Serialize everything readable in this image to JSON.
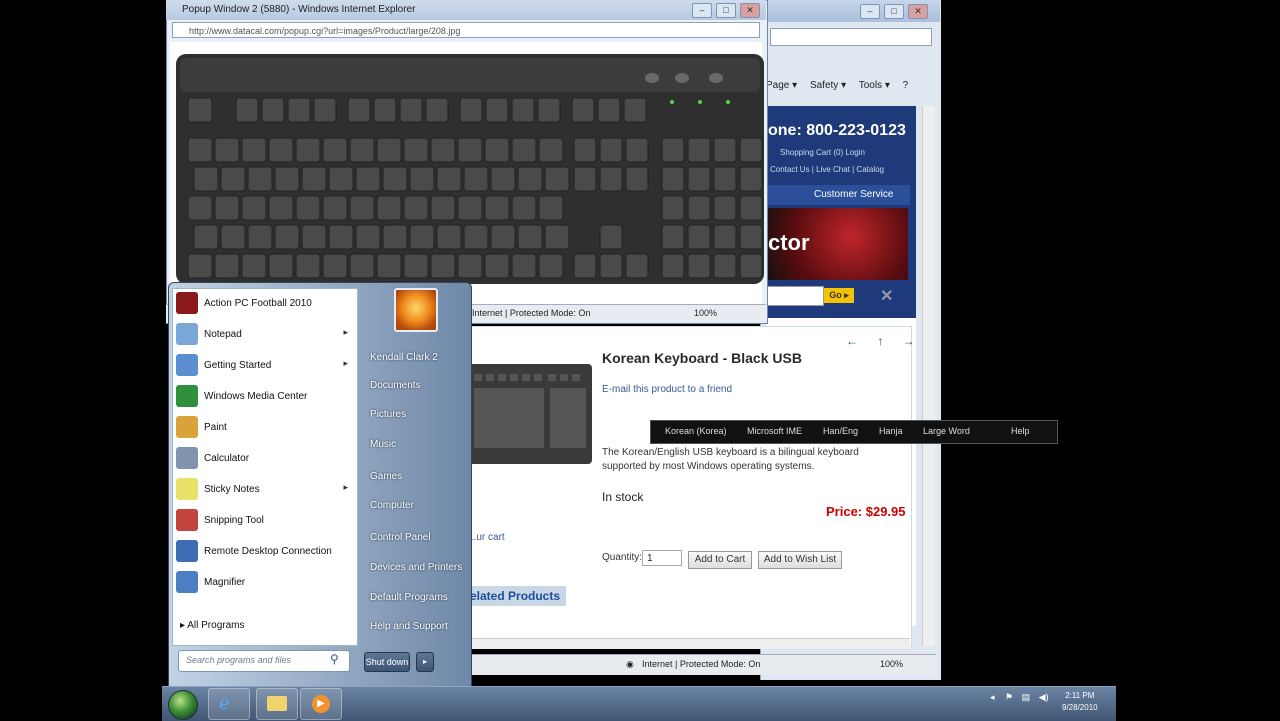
{
  "bg_window": {
    "cmdbar": [
      "Page ▾",
      "Safety ▾",
      "Tools ▾",
      "?"
    ],
    "phone": "one: 800-223-0123",
    "links_row1": "Shopping Cart (0)   Login",
    "links_row2": "Contact Us | Live Chat | Catalog",
    "nav": "Customer Service",
    "banner_text": "ctor",
    "go_button": "Go ▸",
    "status_text": "Internet | Protected Mode: On",
    "zoom": "100%"
  },
  "product": {
    "nav_arrows": "← ↑ →",
    "title": "Korean Keyboard - Black USB",
    "email_link": "E-mail this product to a friend",
    "description": "The Korean/English USB keyboard is a bilingual keyboard supported by most Windows operating systems.",
    "stock": "In stock",
    "price": "Price: $29.95",
    "quantity_label": "Quantity:",
    "quantity_value": "1",
    "add_to_cart": "Add to Cart",
    "add_to_wishlist": "Add to Wish List",
    "cart_link": "...ur cart",
    "related_tab": "elated Products"
  },
  "langbar": {
    "lang": "Korean (Korea)",
    "ime": "Microsoft IME",
    "hanja": "Han/Eng",
    "hangul": "Hanja",
    "large_word": "Large Word",
    "help": "Help"
  },
  "popup": {
    "title": "Popup Window 2 (5880) - Windows Internet Explorer",
    "address": "http://www.datacal.com/popup.cgi?url=images/Product/large/208.jpg",
    "status": "Internet | Protected Mode: On",
    "zoom": "100%"
  },
  "start_menu": {
    "programs": [
      {
        "label": "Action PC Football 2010",
        "arrow": "",
        "color": "#8b1a1a"
      },
      {
        "label": "Notepad",
        "arrow": "▸",
        "color": "#7aa7d6"
      },
      {
        "label": "Getting Started",
        "arrow": "▸",
        "color": "#5c8fd0"
      },
      {
        "label": "Windows Media Center",
        "arrow": "",
        "color": "#2f8f3a"
      },
      {
        "label": "Paint",
        "arrow": "",
        "color": "#d9a23b"
      },
      {
        "label": "Calculator",
        "arrow": "",
        "color": "#8095ad"
      },
      {
        "label": "Sticky Notes",
        "arrow": "▸",
        "color": "#e8e26a"
      },
      {
        "label": "Snipping Tool",
        "arrow": "",
        "color": "#c2453d"
      },
      {
        "label": "Remote Desktop Connection",
        "arrow": "",
        "color": "#3e6db3"
      },
      {
        "label": "Magnifier",
        "arrow": "",
        "color": "#4a7fc4"
      }
    ],
    "all_programs": "▸  All Programs",
    "search_placeholder": "Search programs and files",
    "right_items": [
      "Kendall Clark 2",
      "Documents",
      "Pictures",
      "Music",
      "Games",
      "Computer",
      "Control Panel",
      "Devices and Printers",
      "Default Programs",
      "Help and Support"
    ],
    "shutdown": "Shut down",
    "shutdown_arrow": "▸"
  },
  "taskbar": {
    "clock_time": "2:11 PM",
    "clock_date": "9/28/2010"
  }
}
